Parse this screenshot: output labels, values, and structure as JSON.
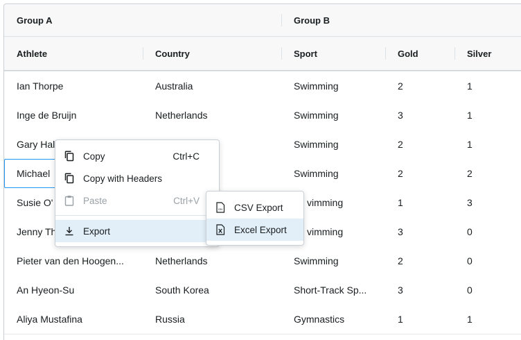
{
  "header": {
    "groups": [
      "Group A",
      "Group B"
    ],
    "columns": [
      "Athlete",
      "Country",
      "Sport",
      "Gold",
      "Silver"
    ]
  },
  "rows": [
    [
      "Ian Thorpe",
      "Australia",
      "Swimming",
      "2",
      "1"
    ],
    [
      "Inge de Bruijn",
      "Netherlands",
      "Swimming",
      "3",
      "1"
    ],
    [
      "Gary Hal",
      "",
      "Swimming",
      "2",
      "1"
    ],
    [
      "Michael",
      "",
      "Swimming",
      "2",
      "2"
    ],
    [
      "Susie O'",
      "",
      "vimming",
      "1",
      "3"
    ],
    [
      "Jenny Th",
      "",
      "vimming",
      "3",
      "0"
    ],
    [
      "Pieter van den Hoogen...",
      "Netherlands",
      "Swimming",
      "2",
      "0"
    ],
    [
      "An Hyeon-Su",
      "South Korea",
      "Short-Track Sp...",
      "3",
      "0"
    ],
    [
      "Aliya Mustafina",
      "Russia",
      "Gymnastics",
      "1",
      "1"
    ]
  ],
  "context_menu": {
    "items": [
      {
        "label": "Copy",
        "shortcut": "Ctrl+C",
        "icon": "copy-icon"
      },
      {
        "label": "Copy with Headers",
        "shortcut": "",
        "icon": "copy-icon"
      },
      {
        "label": "Paste",
        "shortcut": "Ctrl+V",
        "icon": "clipboard-icon",
        "disabled": true
      },
      {
        "label": "Export",
        "shortcut": "",
        "icon": "download-icon",
        "has_submenu": true
      }
    ]
  },
  "submenu": {
    "items": [
      {
        "label": "CSV Export",
        "icon": "csv-file-icon"
      },
      {
        "label": "Excel Export",
        "icon": "excel-file-icon"
      }
    ]
  },
  "colors": {
    "focus": "#2196f3",
    "active_item": "#e2eff9",
    "border": "#c9cfd4"
  }
}
